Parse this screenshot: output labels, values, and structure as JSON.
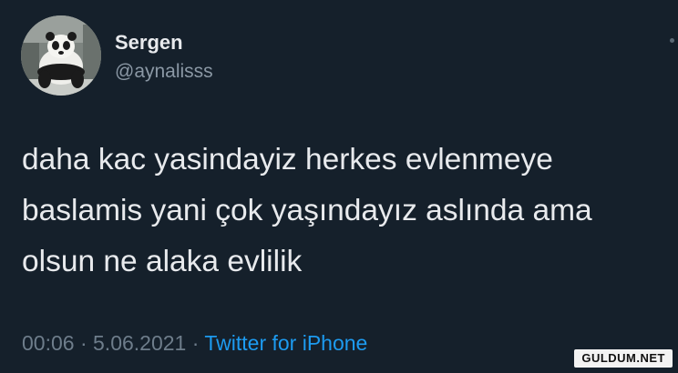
{
  "user": {
    "display_name": "Sergen",
    "handle": "@aynalisss"
  },
  "tweet": {
    "lines": [
      "daha kac yasindayiz herkes evlenmeye",
      "baslamis yani çok yaşındayız aslında ama",
      "olsun ne alaka evlilik"
    ]
  },
  "meta": {
    "time": "00:06",
    "separator": " · ",
    "date": "5.06.2021",
    "source": "Twitter for iPhone"
  },
  "watermark": {
    "text": "GULDUM.NET"
  },
  "icons": {
    "avatar": "panda-avatar",
    "more": "more-options-dot-icon"
  },
  "colors": {
    "background": "#15202b",
    "text": "#e8eaed",
    "secondary": "#8b98a5",
    "link": "#1d9bf0"
  }
}
